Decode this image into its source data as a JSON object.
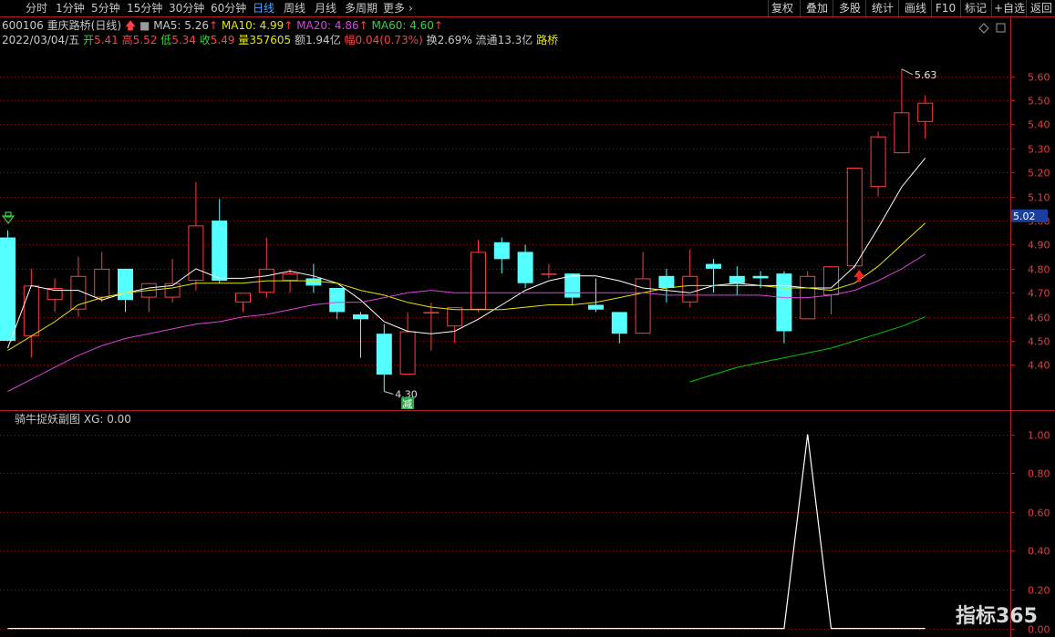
{
  "toolbar": {
    "tabs": [
      "分时",
      "1分钟",
      "5分钟",
      "15分钟",
      "30分钟",
      "60分钟",
      "日线",
      "周线",
      "月线",
      "多周期",
      "更多"
    ],
    "active_tab": "日线",
    "right_buttons": [
      "复权",
      "叠加",
      "多股",
      "统计",
      "画线",
      "F10",
      "标记",
      "+自选",
      "返回"
    ]
  },
  "header": {
    "code": "600106",
    "name": "重庆路桥",
    "period": "(日线)",
    "ma5_label": "MA5: 5.26",
    "ma10_label": "MA10: 4.99",
    "ma20_label": "MA20: 4.86",
    "ma60_label": "MA60: 4.60",
    "date": "2022/03/04/五",
    "open_label": "开",
    "open": "5.41",
    "high_label": "高",
    "high": "5.52",
    "low_label": "低",
    "low": "5.34",
    "close_label": "收",
    "close": "5.49",
    "volume_label": "量",
    "volume": "357605",
    "amount_label": "额",
    "amount": "1.94亿",
    "change_label": "幅",
    "change": "0.04(0.73%)",
    "turnover_label": "换",
    "turnover": "2.69%",
    "float_label": "流通",
    "float_cap": "13.3亿",
    "concept": "路桥"
  },
  "annotations": {
    "max_price": "5.63",
    "min_price": "4.30",
    "reduce_tag": "减",
    "current_price": "5.02"
  },
  "sub_indicator": {
    "name": "骑牛捉妖副图",
    "xg_label": "XG: 0.00"
  },
  "watermark": "指标365",
  "colors": {
    "up": "#ff3c3c",
    "down": "#54ffff",
    "ma5": "#ffffff",
    "ma10": "#e6e600",
    "ma20": "#e040e0",
    "ma60": "#00c800",
    "grid": "#8a1a1a",
    "axis": "#b01e1e"
  },
  "chart_data": [
    {
      "type": "candlestick",
      "ylim": [
        4.22,
        5.72
      ],
      "y_ticks": [
        4.4,
        4.5,
        4.6,
        4.7,
        4.8,
        4.9,
        5.0,
        5.1,
        5.2,
        5.3,
        5.4,
        5.5,
        5.6
      ],
      "candles": [
        {
          "o": 4.93,
          "h": 4.96,
          "l": 4.5,
          "c": 4.5
        },
        {
          "o": 4.52,
          "h": 4.8,
          "l": 4.43,
          "c": 4.73
        },
        {
          "o": 4.67,
          "h": 4.76,
          "l": 4.62,
          "c": 4.72
        },
        {
          "o": 4.63,
          "h": 4.85,
          "l": 4.6,
          "c": 4.77
        },
        {
          "o": 4.68,
          "h": 4.87,
          "l": 4.66,
          "c": 4.8
        },
        {
          "o": 4.8,
          "h": 4.74,
          "l": 4.62,
          "c": 4.67
        },
        {
          "o": 4.68,
          "h": 4.73,
          "l": 4.62,
          "c": 4.74
        },
        {
          "o": 4.68,
          "h": 4.84,
          "l": 4.66,
          "c": 4.74
        },
        {
          "o": 4.75,
          "h": 5.16,
          "l": 4.71,
          "c": 4.98
        },
        {
          "o": 5.0,
          "h": 5.09,
          "l": 4.74,
          "c": 4.75
        },
        {
          "o": 4.66,
          "h": 4.7,
          "l": 4.62,
          "c": 4.7
        },
        {
          "o": 4.7,
          "h": 4.93,
          "l": 4.68,
          "c": 4.8
        },
        {
          "o": 4.75,
          "h": 4.8,
          "l": 4.7,
          "c": 4.78
        },
        {
          "o": 4.76,
          "h": 4.82,
          "l": 4.7,
          "c": 4.73
        },
        {
          "o": 4.72,
          "h": 4.72,
          "l": 4.59,
          "c": 4.62
        },
        {
          "o": 4.61,
          "h": 4.62,
          "l": 4.43,
          "c": 4.59
        },
        {
          "o": 4.53,
          "h": 4.57,
          "l": 4.29,
          "c": 4.36
        },
        {
          "o": 4.36,
          "h": 4.62,
          "l": 4.36,
          "c": 4.54
        },
        {
          "o": 4.62,
          "h": 4.66,
          "l": 4.46,
          "c": 4.62
        },
        {
          "o": 4.56,
          "h": 4.64,
          "l": 4.49,
          "c": 4.64
        },
        {
          "o": 4.63,
          "h": 4.92,
          "l": 4.62,
          "c": 4.87
        },
        {
          "o": 4.91,
          "h": 4.93,
          "l": 4.78,
          "c": 4.84
        },
        {
          "o": 4.87,
          "h": 4.9,
          "l": 4.72,
          "c": 4.74
        },
        {
          "o": 4.78,
          "h": 4.82,
          "l": 4.76,
          "c": 4.78
        },
        {
          "o": 4.78,
          "h": 4.77,
          "l": 4.65,
          "c": 4.68
        },
        {
          "o": 4.65,
          "h": 4.76,
          "l": 4.62,
          "c": 4.63
        },
        {
          "o": 4.62,
          "h": 4.61,
          "l": 4.49,
          "c": 4.53
        },
        {
          "o": 4.53,
          "h": 4.87,
          "l": 4.53,
          "c": 4.76
        },
        {
          "o": 4.77,
          "h": 4.8,
          "l": 4.66,
          "c": 4.72
        },
        {
          "o": 4.66,
          "h": 4.88,
          "l": 4.64,
          "c": 4.77
        },
        {
          "o": 4.82,
          "h": 4.84,
          "l": 4.7,
          "c": 4.8
        },
        {
          "o": 4.77,
          "h": 4.81,
          "l": 4.69,
          "c": 4.74
        },
        {
          "o": 4.77,
          "h": 4.79,
          "l": 4.72,
          "c": 4.76
        },
        {
          "o": 4.78,
          "h": 4.79,
          "l": 4.49,
          "c": 4.54
        },
        {
          "o": 4.59,
          "h": 4.79,
          "l": 4.59,
          "c": 4.77
        },
        {
          "o": 4.69,
          "h": 4.81,
          "l": 4.61,
          "c": 4.81
        },
        {
          "o": 4.81,
          "h": 5.22,
          "l": 4.8,
          "c": 5.22
        },
        {
          "o": 5.14,
          "h": 5.37,
          "l": 5.1,
          "c": 5.35
        },
        {
          "o": 5.28,
          "h": 5.63,
          "l": 5.28,
          "c": 5.45
        },
        {
          "o": 5.41,
          "h": 5.52,
          "l": 5.34,
          "c": 5.49
        }
      ],
      "series": [
        {
          "name": "MA5",
          "values": [
            4.47,
            4.73,
            4.71,
            4.71,
            4.67,
            4.7,
            4.72,
            4.73,
            4.8,
            4.76,
            4.76,
            4.77,
            4.79,
            4.77,
            4.74,
            4.67,
            4.58,
            4.54,
            4.53,
            4.54,
            4.59,
            4.65,
            4.71,
            4.75,
            4.77,
            4.77,
            4.75,
            4.72,
            4.71,
            4.7,
            4.73,
            4.74,
            4.73,
            4.73,
            4.72,
            4.72,
            4.81,
            4.97,
            5.14,
            5.26
          ]
        },
        {
          "name": "MA10",
          "values": [
            4.46,
            4.52,
            4.58,
            4.65,
            4.68,
            4.7,
            4.71,
            4.72,
            4.74,
            4.74,
            4.74,
            4.75,
            4.75,
            4.75,
            4.74,
            4.71,
            4.69,
            4.66,
            4.64,
            4.63,
            4.63,
            4.63,
            4.64,
            4.65,
            4.65,
            4.66,
            4.68,
            4.7,
            4.72,
            4.73,
            4.73,
            4.73,
            4.73,
            4.72,
            4.72,
            4.71,
            4.74,
            4.81,
            4.9,
            4.99
          ]
        },
        {
          "name": "MA20",
          "values": [
            4.29,
            4.34,
            4.39,
            4.44,
            4.48,
            4.51,
            4.53,
            4.55,
            4.57,
            4.58,
            4.6,
            4.61,
            4.63,
            4.65,
            4.66,
            4.66,
            4.68,
            4.7,
            4.71,
            4.7,
            4.7,
            4.7,
            4.7,
            4.7,
            4.7,
            4.7,
            4.7,
            4.7,
            4.69,
            4.69,
            4.69,
            4.69,
            4.69,
            4.68,
            4.68,
            4.69,
            4.71,
            4.75,
            4.8,
            4.86
          ]
        },
        {
          "name": "MA60",
          "values": [
            null,
            null,
            null,
            null,
            null,
            null,
            null,
            null,
            null,
            null,
            null,
            null,
            null,
            null,
            null,
            null,
            null,
            null,
            null,
            null,
            null,
            null,
            null,
            null,
            null,
            null,
            null,
            null,
            null,
            4.33,
            4.36,
            4.39,
            4.41,
            4.43,
            4.45,
            4.47,
            4.5,
            4.53,
            4.56,
            4.6
          ]
        }
      ]
    },
    {
      "type": "line",
      "name": "骑牛捉妖副图",
      "ylim": [
        -0.03,
        1.05
      ],
      "y_ticks": [
        0.0,
        0.2,
        0.4,
        0.6,
        0.8,
        1.0
      ],
      "y_tick_labels": [
        "0.00",
        "0.20",
        "0.40",
        "0.60",
        "0.80",
        "1.00"
      ],
      "series": [
        {
          "name": "XG",
          "values": [
            0,
            0,
            0,
            0,
            0,
            0,
            0,
            0,
            0,
            0,
            0,
            0,
            0,
            0,
            0,
            0,
            0,
            0,
            0,
            0,
            0,
            0,
            0,
            0,
            0,
            0,
            0,
            0,
            0,
            0,
            0,
            0,
            0,
            0,
            1,
            0,
            0,
            0,
            0,
            0
          ]
        }
      ]
    }
  ]
}
